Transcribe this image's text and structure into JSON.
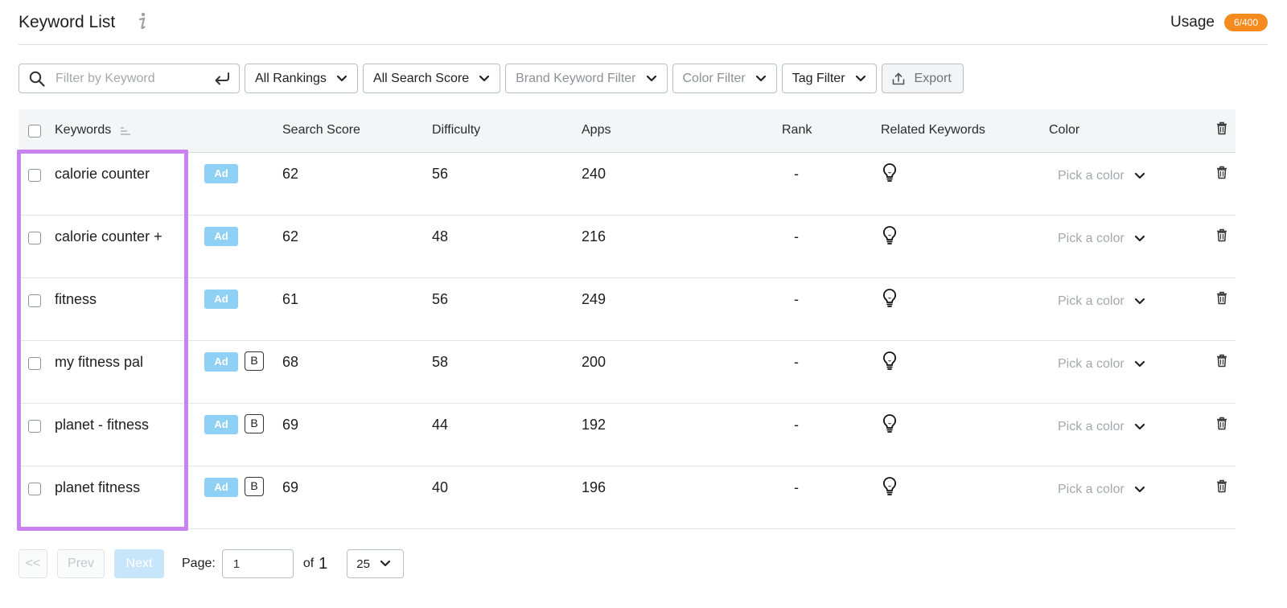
{
  "header": {
    "title": "Keyword List",
    "info_icon": "info-icon",
    "usage_label": "Usage",
    "usage_badge": "6/400",
    "usage_color": "#f58b1f"
  },
  "toolbar": {
    "search_placeholder": "Filter by Keyword",
    "search_value": "",
    "filters": {
      "rankings": "All Rankings",
      "search_score": "All Search Score",
      "brand_keyword": "Brand Keyword Filter",
      "color": "Color Filter",
      "tag": "Tag Filter"
    },
    "export_label": "Export"
  },
  "table": {
    "headers": {
      "keywords": "Keywords",
      "search_score": "Search Score",
      "difficulty": "Difficulty",
      "apps": "Apps",
      "rank": "Rank",
      "related": "Related Keywords",
      "color": "Color"
    },
    "badge_ad": "Ad",
    "badge_brand": "B",
    "pick_color": "Pick a color",
    "rows": [
      {
        "keyword": "calorie counter",
        "brand": false,
        "search_score": "62",
        "difficulty": "56",
        "apps": "240",
        "rank": "-"
      },
      {
        "keyword": "calorie counter +",
        "brand": false,
        "search_score": "62",
        "difficulty": "48",
        "apps": "216",
        "rank": "-"
      },
      {
        "keyword": "fitness",
        "brand": false,
        "search_score": "61",
        "difficulty": "56",
        "apps": "249",
        "rank": "-"
      },
      {
        "keyword": "my fitness pal",
        "brand": true,
        "search_score": "68",
        "difficulty": "58",
        "apps": "200",
        "rank": "-"
      },
      {
        "keyword": "planet - fitness",
        "brand": true,
        "search_score": "69",
        "difficulty": "44",
        "apps": "192",
        "rank": "-"
      },
      {
        "keyword": "planet fitness",
        "brand": true,
        "search_score": "69",
        "difficulty": "40",
        "apps": "196",
        "rank": "-"
      }
    ]
  },
  "pagination": {
    "first_label": "<<",
    "prev_label": "Prev",
    "next_label": "Next",
    "page_label": "Page:",
    "page_value": "1",
    "of_label": "of",
    "total_pages": "1",
    "per_page": "25"
  },
  "colors": {
    "highlight": "#c882f2",
    "ad_badge": "#8fd0f5"
  }
}
